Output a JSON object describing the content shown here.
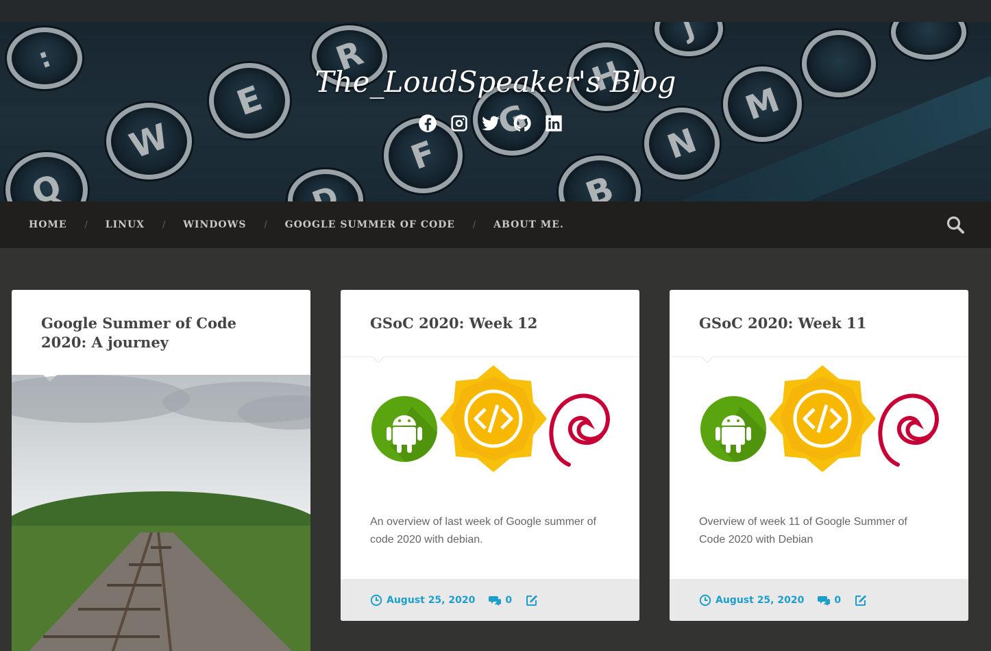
{
  "site": {
    "title": "The_LoudSpeaker's Blog",
    "socials": [
      "facebook-icon",
      "instagram-icon",
      "twitter-icon",
      "github-icon",
      "linkedin-icon"
    ],
    "banner_keys": [
      "Q",
      "W",
      "E",
      "R",
      "F",
      "D",
      "G",
      "H",
      "B",
      "N",
      "M",
      ":",
      "J"
    ]
  },
  "nav": {
    "items": [
      {
        "label": "HOME"
      },
      {
        "label": "LINUX"
      },
      {
        "label": "WINDOWS"
      },
      {
        "label": "GOOGLE SUMMER OF CODE"
      },
      {
        "label": "ABOUT ME."
      }
    ],
    "separator": "/",
    "search_icon": "search-icon"
  },
  "colors": {
    "accent": "#1d9ecb",
    "background": "#333331",
    "nav_bg": "#201f1e",
    "card_footer": "#e9e9e9"
  },
  "posts": [
    {
      "title": "Google Summer of Code 2020: A journey",
      "image": "railway-track-photo"
    },
    {
      "title": "GSoC 2020: Week 12",
      "image": "android-gsoc-debian-logos",
      "excerpt": "An overview of last week of Google summer of code 2020 with debian.",
      "date": "August 25, 2020",
      "comments": "0"
    },
    {
      "title": "GSoC 2020: Week 11",
      "image": "android-gsoc-debian-logos",
      "excerpt": "Overview of week 11 of Google Summer of Code 2020 with Debian",
      "date": "August 25, 2020",
      "comments": "0"
    }
  ]
}
